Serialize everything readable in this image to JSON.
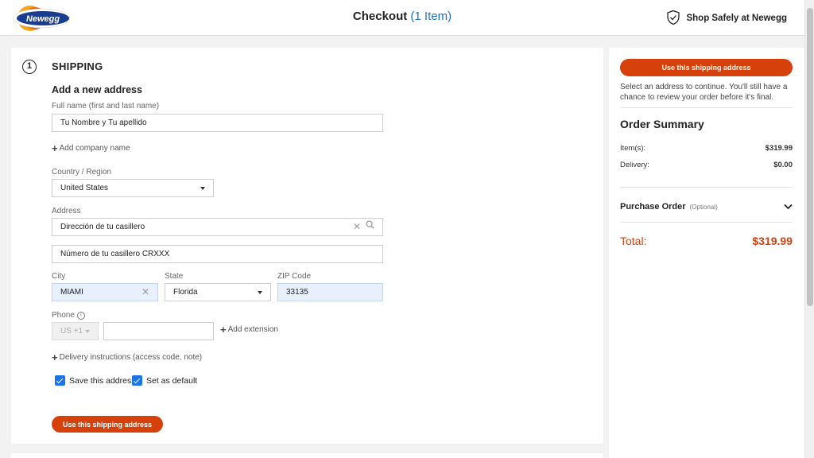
{
  "header": {
    "logo_text": "Newegg",
    "title": "Checkout",
    "item_count": "(1 Item)",
    "shop_safely": "Shop Safely at Newegg"
  },
  "shipping": {
    "step_number": "1",
    "section_title": "SHIPPING",
    "form_heading": "Add a new address",
    "full_name_label": "Full name (first and last name)",
    "full_name_value": "Tu Nombre y Tu apellido",
    "add_company": "Add company name",
    "country_label": "Country / Region",
    "country_value": "United States",
    "address_label": "Address",
    "address_line1": "Dirección de tu casillero",
    "address_line2": "Número de tu casillero CRXXX",
    "city_label": "City",
    "city_value": "MIAMI",
    "state_label": "State",
    "state_value": "Florida",
    "zip_label": "ZIP Code",
    "zip_value": "33135",
    "phone_label": "Phone",
    "phone_country": "US +1",
    "phone_value": "",
    "add_extension": "Add extension",
    "delivery_instructions": "Delivery instructions (access code, note)",
    "save_address": "Save this address",
    "set_default": "Set as default",
    "submit_button": "Use this shipping address"
  },
  "sidebar": {
    "top_button": "Use this shipping address",
    "note": "Select an address to continue. You'll still have a chance to review your order before it's final.",
    "summary_title": "Order Summary",
    "items_label": "Item(s):",
    "items_value": "$319.99",
    "delivery_label": "Delivery:",
    "delivery_value": "$0.00",
    "po_label": "Purchase Order",
    "po_optional": "(Optional)",
    "total_label": "Total:",
    "total_value": "$319.99"
  },
  "colors": {
    "accent": "#d6400b",
    "link_blue": "#1f6fd0",
    "checkbox_blue": "#1a73e8",
    "autofill_bg": "#e8f0fe"
  }
}
